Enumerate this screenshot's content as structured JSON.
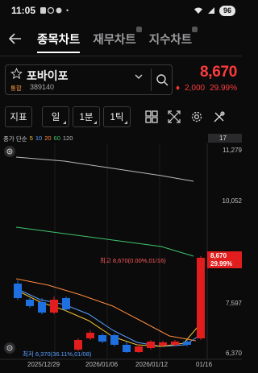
{
  "status": {
    "time": "11:05",
    "battery": "96"
  },
  "header": {
    "tabs": [
      {
        "label": "종목차트"
      },
      {
        "label": "재무차트"
      },
      {
        "label": "지수차트"
      }
    ]
  },
  "stock": {
    "name": "포바이포",
    "market_badge": "통합",
    "code": "389140",
    "price": "8,670",
    "change": "2,000",
    "change_pct": "29.99%"
  },
  "toolbar": {
    "indicator_label": "지표",
    "period_label": "일",
    "minute_label": "1분",
    "tick_label": "1틱"
  },
  "legend": {
    "prefix": "종가 단순",
    "ma": [
      {
        "label": "5",
        "color": "#f2c12e"
      },
      {
        "label": "10",
        "color": "#5aa0ff"
      },
      {
        "label": "20",
        "color": "#ff8a3c"
      },
      {
        "label": "60",
        "color": "#3ec46d"
      },
      {
        "label": "120",
        "color": "#b9b9bb"
      }
    ]
  },
  "chart": {
    "visible_count": "17",
    "y_ticks": [
      "11,279",
      "10,052",
      "7,597",
      "6,370"
    ],
    "x_ticks": [
      "2025/12/29",
      "2026/01/06",
      "2026/01/12",
      "01/16"
    ],
    "price_tag": {
      "price": "8,670",
      "pct": "29.99%"
    },
    "high_annotation": "최고 8,670(0.00%,01/16)",
    "low_annotation": "최저 6,370(36.11%,01/08)",
    "colors": {
      "up": "#e11d1d",
      "down": "#1e6fe0"
    }
  },
  "chart_data": {
    "type": "candlestick",
    "y_axis_ticks": [
      11279,
      10052,
      7597,
      6370
    ],
    "x_axis_ticks": [
      "2025/12/29",
      "2026/01/06",
      "2026/01/12",
      "01/16"
    ],
    "annotations": [
      "최고 8,670(0.00%,01/16)",
      "최저 6,370(36.11%,01/08)"
    ]
  }
}
